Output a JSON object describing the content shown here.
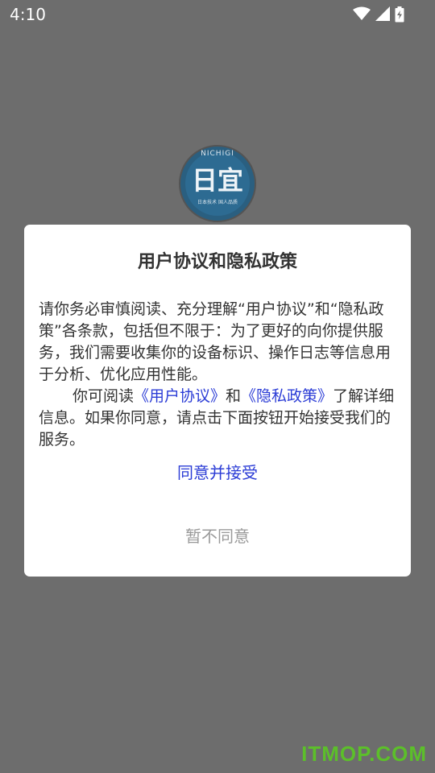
{
  "status_bar": {
    "time": "4:10",
    "icons": [
      "wifi-icon",
      "signal-icon",
      "battery-icon"
    ]
  },
  "logo": {
    "ring_text": "NICHIGI",
    "main_text": "日宜",
    "sub_text": "日本技术 国人品质"
  },
  "dialog": {
    "title": "用户协议和隐私政策",
    "paragraph1": "请你务必审慎阅读、充分理解“用户协议”和“隐私政策”各条款，包括但不限于：为了更好的向你提供服务，我们需要收集你的设备标识、操作日志等信息用于分析、优化应用性能。",
    "paragraph2_prefix": "你可阅读",
    "user_agreement_link": "《用户协议》",
    "and_text": "和",
    "privacy_policy_link": "《隐私政策》",
    "paragraph2_suffix": "了解详细信息。如果你同意，请点击下面按钮开始接受我们的服务。",
    "agree_label": "同意并接受",
    "disagree_label": "暂不同意"
  },
  "watermark": "ITMOP.COM",
  "colors": {
    "overlay": "#6d6d6d",
    "link": "#2b3cd6",
    "secondary": "#9a9a9a",
    "watermark": "#5cbf2a"
  }
}
